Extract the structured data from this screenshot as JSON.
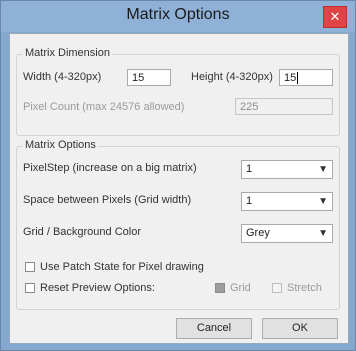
{
  "window": {
    "title": "Matrix Options",
    "close_glyph": "✕"
  },
  "dimension": {
    "legend": "Matrix Dimension",
    "width_label": "Width (4-320px)",
    "width_value": "15",
    "height_label": "Height (4-320px)",
    "height_value": "15",
    "pixel_count_label": "Pixel Count (max 24576 allowed)",
    "pixel_count_value": "225"
  },
  "options": {
    "legend": "Matrix Options",
    "pixelstep_label": "PixelStep (increase on a big matrix)",
    "pixelstep_value": "1",
    "space_label": "Space between Pixels (Grid width)",
    "space_value": "1",
    "grid_color_label": "Grid / Background Color",
    "grid_color_value": "Grey",
    "patch_state_label": "Use Patch State for Pixel drawing",
    "reset_preview_label": "Reset Preview Options:",
    "grid_label": "Grid",
    "stretch_label": "Stretch",
    "dropdown_arrow": "▼"
  },
  "buttons": {
    "cancel": "Cancel",
    "ok": "OK"
  },
  "colors": {
    "titlebar": "#8fb1d8",
    "close": "#e04343"
  }
}
